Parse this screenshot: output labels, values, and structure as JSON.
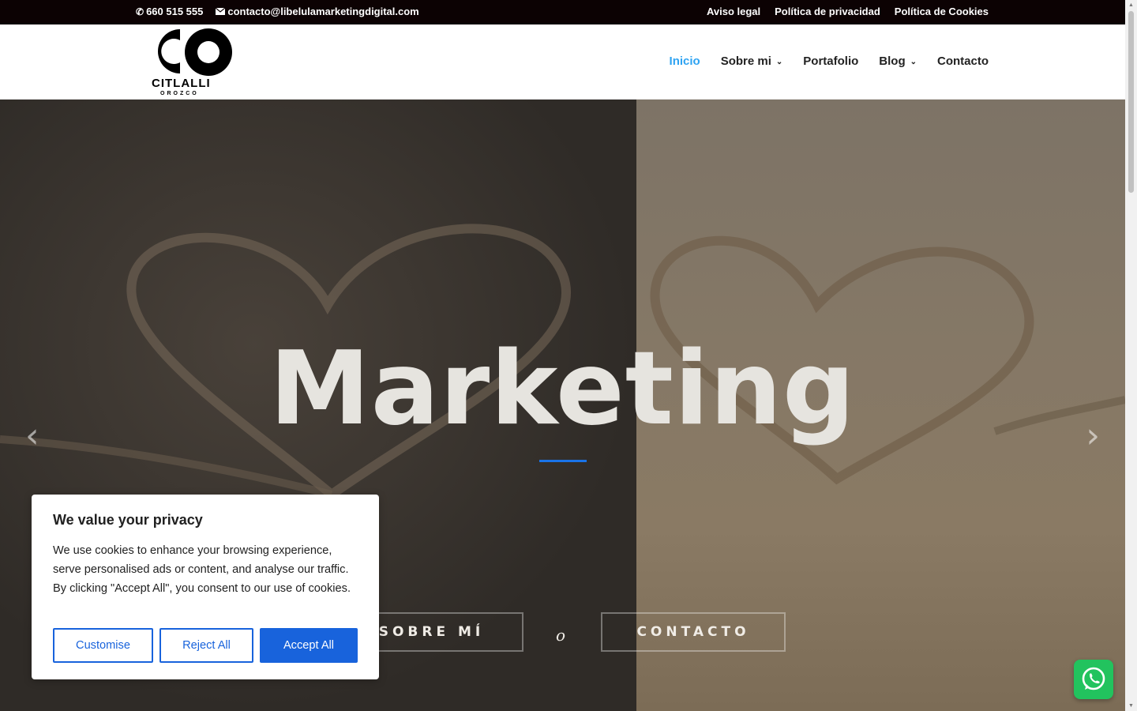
{
  "topbar": {
    "phone": "660 515 555",
    "email": "contacto@libelulamarketingdigital.com",
    "links": [
      "Aviso legal",
      "Política de privacidad",
      "Política de Cookies"
    ]
  },
  "header": {
    "logo_name": "CITLALLI",
    "logo_sub": "OROZCO",
    "nav": [
      {
        "label": "Inicio",
        "active": true
      },
      {
        "label": "Sobre mi",
        "dropdown": true
      },
      {
        "label": "Portafolio"
      },
      {
        "label": "Blog",
        "dropdown": true
      },
      {
        "label": "Contacto"
      }
    ]
  },
  "hero": {
    "title": "Marketing",
    "button_about": "SOBRE MÍ",
    "or_text": "o",
    "button_contact": "CONTACTO",
    "accent_color": "#1a73e8"
  },
  "cookie": {
    "title": "We value your privacy",
    "text": "We use cookies to enhance your browsing experience, serve personalised ads or content, and analyse our traffic. By clicking \"Accept All\", you consent to our use of cookies.",
    "customise": "Customise",
    "reject": "Reject All",
    "accept": "Accept All",
    "brand_color": "#1863dc"
  },
  "icons": {
    "phone": "phone-icon",
    "mail": "mail-icon",
    "whatsapp": "whatsapp-icon"
  }
}
